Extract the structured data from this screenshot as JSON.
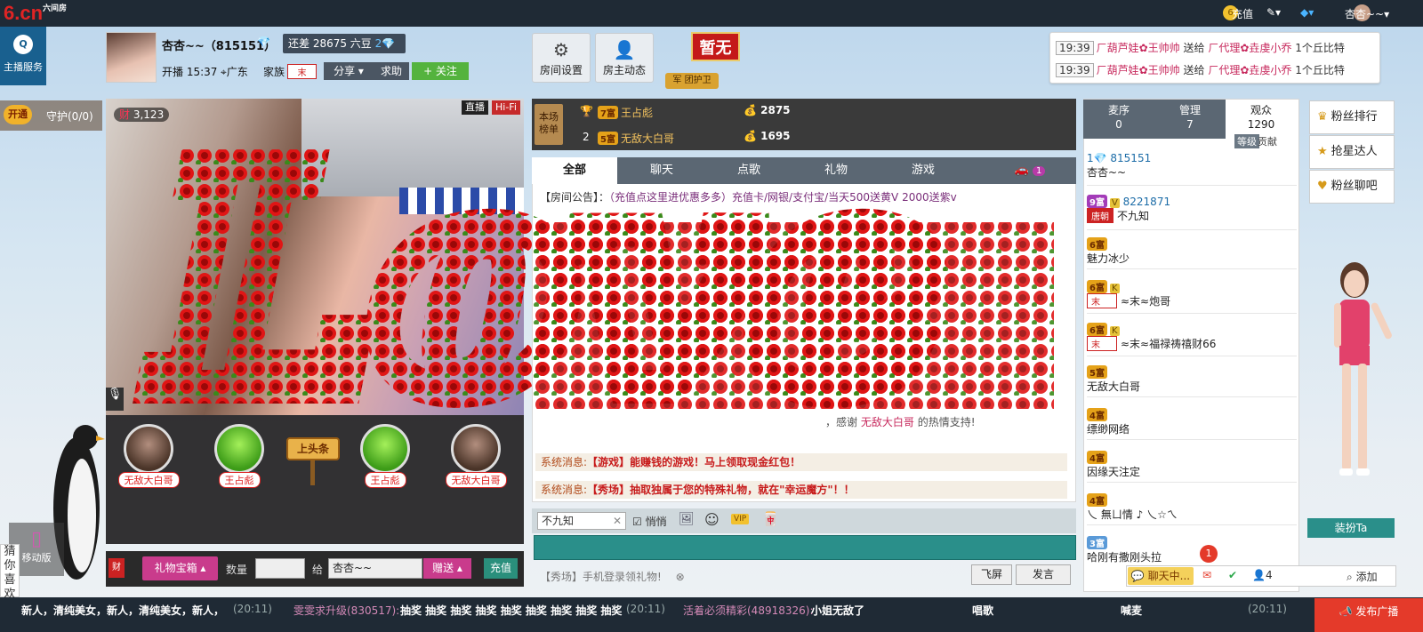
{
  "topbar": {
    "logo": "6.cn",
    "logo_sub": "六间房",
    "coin_symbol": "6",
    "recharge": "充值",
    "user": "杏杏~~"
  },
  "host": {
    "service": "主播服务",
    "name": "杏杏~~（815151）",
    "diamond": "💎",
    "gap": "还差 28675 六豆",
    "gap_icon": "2💎",
    "start": "开播 15:37",
    "location": "广东",
    "family_label": "家族",
    "family_tag": "末",
    "share": "分享",
    "ask": "求助",
    "follow": "+ 关注"
  },
  "buttons": {
    "room_settings": "房间设置",
    "host_feed": "房主动态",
    "flag": "暂无",
    "guard_badge": "团护卫",
    "guard_mark": "军"
  },
  "gift_feed": [
    {
      "time": "19:39",
      "from": "ㄏ葫芦娃✿王帅帅",
      "verb": "送给",
      "to": "ㄏ代理✿垚虔小乔",
      "gift": "1个丘比特"
    },
    {
      "time": "19:39",
      "from": "ㄏ葫芦娃✿王帅帅",
      "verb": "送给",
      "to": "ㄏ代理✿垚虔小乔",
      "gift": "1个丘比特"
    }
  ],
  "guard": {
    "open": "开通",
    "label": "守护(0/0)"
  },
  "video": {
    "fans": "3,123",
    "fans_icon": "财",
    "live": "直播",
    "hifi": "Hi-Fi",
    "mic": "🎙"
  },
  "seats": [
    "无敌大白哥",
    "王占彪",
    "王占彪",
    "无敌大白哥"
  ],
  "headline": "上头条",
  "gift_bar": {
    "treasure": "礼物宝箱",
    "qty_label": "数量",
    "to_label": "给",
    "to_name": "杏杏~~",
    "give": "赠送",
    "recharge": "充值",
    "fortune": "财"
  },
  "rank": {
    "badge": "本场榜单",
    "rows": [
      {
        "pos": "",
        "lvl": "7富",
        "name": "王占彪",
        "score": "2875"
      },
      {
        "pos": "2",
        "lvl": "5富",
        "name": "无敌大白哥",
        "score": "1695"
      }
    ]
  },
  "tabs": [
    "全部",
    "聊天",
    "点歌",
    "礼物",
    "游戏"
  ],
  "car_count": "1",
  "notice": {
    "label": "【房间公告】：",
    "text": "（充值点这里进优惠多多）充值卡/网银/支付宝/当天500送黄V 2000送紫v"
  },
  "thanks": {
    "pre": "，感谢",
    "name": "无敌大白哥",
    "post": "的热情支持!"
  },
  "sysmsgs": [
    {
      "pre": "系统消息:",
      "tag": "【游戏】",
      "text": "能赚钱的游戏！马上领取现金红包！"
    },
    {
      "pre": "系统消息:",
      "tag": "【秀场】",
      "text": "抽取独属于您的特殊礼物，就在\"幸运魔方\"！！"
    }
  ],
  "input": {
    "to": "不九知",
    "whisper": "悄悄",
    "hint": "【秀场】手机登录领礼物!",
    "fly": "飞屏",
    "send": "发言",
    "vip": "VIP"
  },
  "list_tabs": [
    {
      "label": "麦序",
      "count": "0"
    },
    {
      "label": "管理",
      "count": "7"
    },
    {
      "label": "观众",
      "count": "1290"
    }
  ],
  "list_sub": {
    "level": "等级",
    "contrib": "贡献"
  },
  "users": [
    {
      "badge": "1💎",
      "id": "815151",
      "name": "杏杏~~"
    },
    {
      "badge": "9富",
      "k": "V",
      "id": "8221871",
      "tag": "唐朝",
      "name": "不九知"
    },
    {
      "badge": "6富",
      "name": "魅力冰少"
    },
    {
      "badge": "6富",
      "k": "K",
      "tag": "末",
      "name": "≈末≈炮哥"
    },
    {
      "badge": "6富",
      "k": "K",
      "tag": "末",
      "name": "≈末≈福禄祷禧财66"
    },
    {
      "badge": "5富",
      "name": "无敌大白哥"
    },
    {
      "badge": "4富",
      "name": "缥缈网络"
    },
    {
      "badge": "4富",
      "name": "因缘天注定"
    },
    {
      "badge": "4富",
      "name": "乀 無ㄩ情 ♪ 乀☆ㄟ"
    },
    {
      "badge": "3富",
      "name": "哈刚有撒刚头拉"
    }
  ],
  "side": {
    "fans_rank": "粉丝排行",
    "star": "抢星达人",
    "fans_bar": "粉丝聊吧",
    "dress": "装扮Ta"
  },
  "status": {
    "chat": "聊天中...",
    "notif": "1",
    "people": "4",
    "add": "添加"
  },
  "mobile": "移动版",
  "guess": "猜你喜欢",
  "ticker": [
    {
      "text": "新人，清纯美女，新人，清纯美女，新人，",
      "time": "(20:11)"
    },
    {
      "text": "雯雯求升级(830517):",
      "body": "抽奖 抽奖 抽奖 抽奖 抽奖 抽奖 抽奖 抽奖 抽奖",
      "time": "(20:11)"
    },
    {
      "text": "活着必须精彩(48918326):",
      "body": "小姐无敌了",
      "extra1": "唱歌",
      "extra2": "喊麦",
      "time": "(20:11)"
    }
  ],
  "publish": "发布广播",
  "overlay": "Love"
}
